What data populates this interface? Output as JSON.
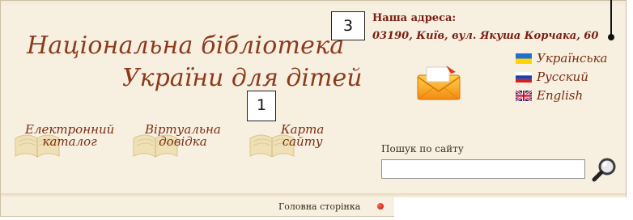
{
  "header": {
    "title_line1": "Національна бібліотека",
    "title_line2": "України для дітей"
  },
  "address": {
    "heading": "Наша адреса:",
    "text": "03190, Київ, вул. Якуша Корчака, 60"
  },
  "nav": {
    "catalog": [
      "Електронний",
      "каталог"
    ],
    "virtual_reference": [
      "Віртуальна",
      "довідка"
    ],
    "site_map": [
      "Карта",
      "сайту"
    ]
  },
  "languages": [
    {
      "label": "Українська"
    },
    {
      "label": "Русский"
    },
    {
      "label": "English"
    }
  ],
  "search": {
    "label": "Пошук по сайту",
    "value": ""
  },
  "breadcrumb": {
    "home": "Головна сторінка"
  },
  "markers": {
    "one": "1",
    "three": "3"
  },
  "colors": {
    "page_background": "#f7f0e1",
    "title_text": "#8c3a1c",
    "link_text": "#7a2d12"
  },
  "icons": [
    "envelope-icon",
    "book-icon",
    "flag-ukraine-icon",
    "flag-russia-icon",
    "flag-uk-icon",
    "magnifier-icon",
    "bullet-icon"
  ]
}
